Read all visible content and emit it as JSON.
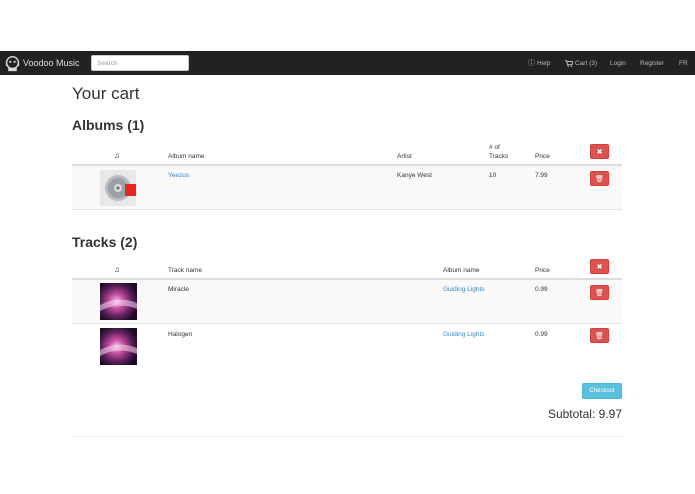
{
  "navbar": {
    "brand": "Voodoo Music",
    "search_placeholder": "Search",
    "help": "Help",
    "cart": "Cart (3)",
    "login": "Login",
    "register": "Register",
    "lang": "FR"
  },
  "page_title": "Your cart",
  "albums": {
    "title": "Albums (1)",
    "headers": {
      "icon": "♫",
      "name": "Album name",
      "artist": "Artist",
      "tracks": "# of Tracks",
      "price": "Price"
    },
    "rows": [
      {
        "name": "Yeezus",
        "artist": "Kanye West",
        "tracks": "10",
        "price": "7.99"
      }
    ]
  },
  "tracks": {
    "title": "Tracks (2)",
    "headers": {
      "icon": "♫",
      "name": "Track name",
      "album": "Album name",
      "price": "Price"
    },
    "rows": [
      {
        "name": "Miracle",
        "album": "Guiding Lights",
        "price": "0.99"
      },
      {
        "name": "Halogen",
        "album": "Guiding Lights",
        "price": "0.99"
      }
    ]
  },
  "checkout_label": "Checkout",
  "subtotal": "Subtotal: 9.97",
  "colors": {
    "navbar": "#222222",
    "danger": "#d9534f",
    "info": "#5bc0de",
    "link": "#3c87c6"
  },
  "icons": {
    "help": "info-circle-icon",
    "cart": "cart-icon",
    "remove_all": "times-icon",
    "remove_row": "trash-icon",
    "music": "music-note-icon"
  }
}
